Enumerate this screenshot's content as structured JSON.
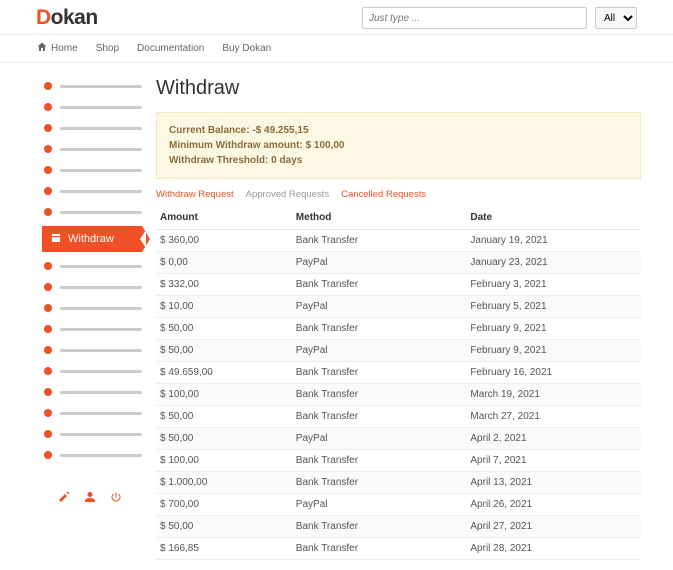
{
  "brand": {
    "first": "D",
    "rest": "okan"
  },
  "search": {
    "placeholder": "Just type ...",
    "filter_selected": "All"
  },
  "nav": {
    "home": "Home",
    "shop": "Shop",
    "docs": "Documentation",
    "buy": "Buy Dokan"
  },
  "sidebar": {
    "active_label": "Withdraw"
  },
  "page": {
    "title": "Withdraw"
  },
  "notice": {
    "line1": "Current Balance: -$ 49.255,15",
    "line2": "Minimum Withdraw amount: $ 100,00",
    "line3": "Withdraw Threshold: 0 days"
  },
  "tabs": {
    "request": "Withdraw Request",
    "approved": "Approved Requests",
    "cancelled": "Cancelled Requests"
  },
  "table": {
    "headers": {
      "amount": "Amount",
      "method": "Method",
      "date": "Date"
    },
    "rows": [
      {
        "amount": "$ 360,00",
        "method": "Bank Transfer",
        "date": "January 19, 2021"
      },
      {
        "amount": "$ 0,00",
        "method": "PayPal",
        "date": "January 23, 2021"
      },
      {
        "amount": "$ 332,00",
        "method": "Bank Transfer",
        "date": "February 3, 2021"
      },
      {
        "amount": "$ 10,00",
        "method": "PayPal",
        "date": "February 5, 2021"
      },
      {
        "amount": "$ 50,00",
        "method": "Bank Transfer",
        "date": "February 9, 2021"
      },
      {
        "amount": "$ 50,00",
        "method": "PayPal",
        "date": "February 9, 2021"
      },
      {
        "amount": "$ 49.659,00",
        "method": "Bank Transfer",
        "date": "February 16, 2021"
      },
      {
        "amount": "$ 100,00",
        "method": "Bank Transfer",
        "date": "March 19, 2021"
      },
      {
        "amount": "$ 50,00",
        "method": "Bank Transfer",
        "date": "March 27, 2021"
      },
      {
        "amount": "$ 50,00",
        "method": "PayPal",
        "date": "April 2, 2021"
      },
      {
        "amount": "$ 100,00",
        "method": "Bank Transfer",
        "date": "April 7, 2021"
      },
      {
        "amount": "$ 1.000,00",
        "method": "Bank Transfer",
        "date": "April 13, 2021"
      },
      {
        "amount": "$ 700,00",
        "method": "PayPal",
        "date": "April 26, 2021"
      },
      {
        "amount": "$ 50,00",
        "method": "Bank Transfer",
        "date": "April 27, 2021"
      },
      {
        "amount": "$ 166,85",
        "method": "Bank Transfer",
        "date": "April 28, 2021"
      }
    ]
  }
}
